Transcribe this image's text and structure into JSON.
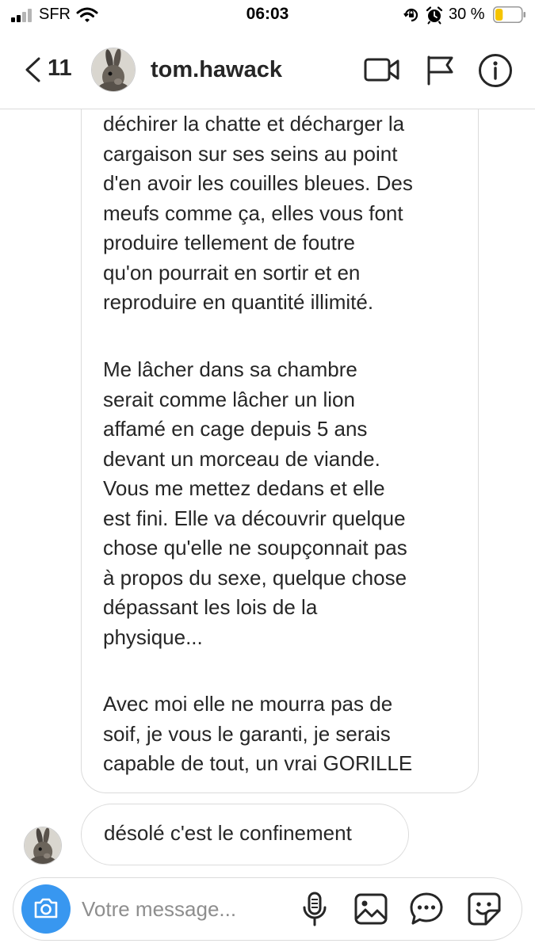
{
  "status_bar": {
    "carrier": "SFR",
    "time": "06:03",
    "battery_percent": "30 %",
    "battery_level": 0.3,
    "battery_color": "#f5c400"
  },
  "header": {
    "back_count": "11",
    "username": "tom.hawack",
    "icons": [
      "chevron-left-icon",
      "video-call-icon",
      "flag-icon",
      "info-icon"
    ]
  },
  "messages": {
    "long_message": {
      "paragraph_1": "déchirer la chatte et décharger la\ncargaison sur ses seins au point\nd'en avoir les couilles bleues. Des\nmeufs comme ça, elles vous font\nproduire tellement de foutre\nqu'on pourrait en sortir et en\nreproduire en quantité illimité.",
      "paragraph_2": "Me lâcher dans sa chambre\nserait comme lâcher un lion\naffamé en cage depuis 5 ans\ndevant un morceau de viande.\nVous me mettez dedans et elle\nest fini. Elle va découvrir quelque\nchose qu'elle ne soupçonnait pas\nà propos du sexe, quelque chose\ndépassant les lois de la\nphysique...",
      "paragraph_3": "Avec moi elle ne mourra pas de\nsoif, je vous le garanti, je serais\ncapable de tout, un vrai GORILLE"
    },
    "short_message": "désolé c'est le confinement"
  },
  "composer": {
    "placeholder": "Votre message...",
    "accent_color": "#3897f0",
    "icons": [
      "camera-icon",
      "microphone-icon",
      "gallery-icon",
      "chat-bubble-icon",
      "sticker-icon"
    ]
  }
}
